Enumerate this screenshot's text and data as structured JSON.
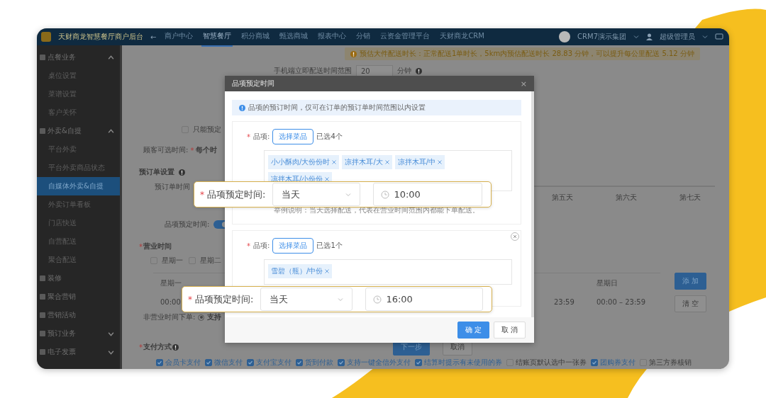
{
  "topbar": {
    "logo_text": "天财商龙智慧餐厅商户后台",
    "back_glyph": "←",
    "org": "CRM7演示集团",
    "user": "超级管理员",
    "nav": [
      {
        "label": "商户中心",
        "selected": false
      },
      {
        "label": "智慧餐厅",
        "selected": true
      },
      {
        "label": "积分商城",
        "selected": false
      },
      {
        "label": "甄选商城",
        "selected": false
      },
      {
        "label": "报表中心",
        "selected": false
      },
      {
        "label": "分销",
        "selected": false
      },
      {
        "label": "云资金管理平台",
        "selected": false
      },
      {
        "label": "天财商龙CRM",
        "selected": false
      }
    ]
  },
  "sidebar": [
    {
      "label": "点餐业务",
      "expanded": true,
      "children": [
        {
          "label": "桌位设置",
          "selected": false
        },
        {
          "label": "菜谱设置",
          "selected": false
        },
        {
          "label": "客户关怀",
          "selected": false
        }
      ]
    },
    {
      "label": "外卖&自提",
      "expanded": true,
      "children": [
        {
          "label": "平台外卖",
          "selected": false
        },
        {
          "label": "平台外卖商品状态",
          "selected": false
        },
        {
          "label": "自媒体外卖&自提",
          "selected": true
        },
        {
          "label": "外卖订单看板",
          "selected": false
        },
        {
          "label": "门店快送",
          "selected": false
        },
        {
          "label": "自营配送",
          "selected": false
        },
        {
          "label": "聚合配送",
          "selected": false
        }
      ]
    },
    {
      "label": "装修"
    },
    {
      "label": "聚合营销"
    },
    {
      "label": "营销活动"
    },
    {
      "label": "预订业务",
      "expanded": false
    },
    {
      "label": "电子发票",
      "expanded": false
    }
  ],
  "page": {
    "notice": "预估大件配送时长：正常配送1单时长，5km内预估配送时长 28.83 分钟，可以提升每公里配送 5.12 分钟",
    "delivery": {
      "label": "手机端立即配送时间范围",
      "value": "20",
      "unit": "分钟"
    },
    "only_preorder": {
      "label": "只能预定",
      "checked": false
    },
    "customer_time": {
      "label": "顾客可选时间:",
      "mark": "*",
      "value": "每个时"
    },
    "preorder_title": "预订单设置",
    "preorder_time": {
      "label": "预订单时间",
      "days": [
        "第五天",
        "第六天",
        "第七天"
      ]
    },
    "item_time": {
      "label": "品项预定时间:",
      "on": true
    },
    "hours": {
      "mark": "*",
      "title": "营业时间",
      "weekdays": [
        {
          "label": "星期一",
          "checked": false
        },
        {
          "label": "星期二",
          "checked": false
        }
      ],
      "columns": [
        "星期一",
        "星期日"
      ],
      "cells": [
        "00:00",
        "23:59",
        "00:00 – 23:59"
      ],
      "add": "添 加",
      "clear": "清 空"
    },
    "off_hours": {
      "label": "非营业时间下单:",
      "option": "支持",
      "selected": true
    },
    "payment": {
      "mark": "*",
      "title": "支付方式",
      "options": [
        {
          "label": "会员卡支付",
          "checked": true
        },
        {
          "label": "微信支付",
          "checked": true
        },
        {
          "label": "支付宝支付",
          "checked": true
        },
        {
          "label": "货到付款",
          "checked": true
        },
        {
          "label": "支持一键全信外支付",
          "checked": true
        },
        {
          "label": "结算时提示有未使用的券",
          "checked": true
        },
        {
          "label": "结账页默认选中一张券",
          "checked": false
        },
        {
          "label": "团购券支付",
          "checked": true
        },
        {
          "label": "第三方券核销",
          "checked": false
        }
      ]
    },
    "actions": {
      "next": "下一步",
      "cancel": "取消"
    }
  },
  "modal": {
    "title": "品项预定时间",
    "close": "×",
    "info": "品项的预订时间，仅可在订单的预订单时间范围以内设置",
    "ok": "确 定",
    "cancel": "取 消",
    "groups": [
      {
        "mark": "*",
        "label": "品项:",
        "button": "选择菜品",
        "count": "已选4个",
        "removable": false,
        "tags": [
          "小小酥肉/大份份时",
          "凉拌木耳/大",
          "凉拌木耳/中",
          "凉拌木耳/小份份"
        ],
        "note": "举例说明：当天选择配送，代表在营业时间范围内都能下单配送。"
      },
      {
        "mark": "*",
        "label": "品项:",
        "button": "选择菜品",
        "count": "已选1个",
        "removable": true,
        "tags": [
          "雪碧（瓶）/中份"
        ]
      }
    ]
  },
  "callouts": [
    {
      "mark": "*",
      "label": "品项预定时间:",
      "day": "当天",
      "time": "10:00"
    },
    {
      "mark": "*",
      "label": "品项预定时间:",
      "day": "当天",
      "time": "16:00"
    }
  ]
}
